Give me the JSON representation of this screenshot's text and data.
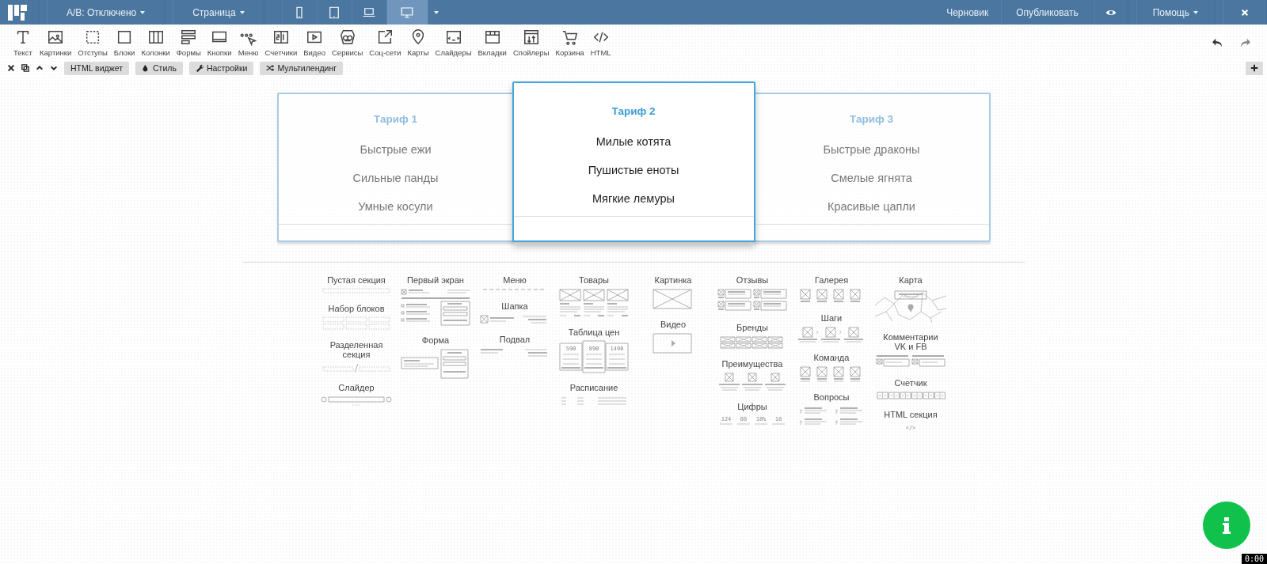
{
  "topbar": {
    "ab_test": "А/В: Отключено",
    "page_menu": "Страница",
    "devices": [
      {
        "kind": "phone",
        "selected": false
      },
      {
        "kind": "tablet",
        "selected": false
      },
      {
        "kind": "laptop",
        "selected": false
      },
      {
        "kind": "desktop",
        "selected": true
      }
    ],
    "draft": "Черновик",
    "publish": "Опубликовать",
    "help": "Помощь"
  },
  "tools": [
    {
      "kind": "text",
      "label": "Текст"
    },
    {
      "kind": "images",
      "label": "Картинки"
    },
    {
      "kind": "padding",
      "label": "Отступы"
    },
    {
      "kind": "blocks",
      "label": "Блоки"
    },
    {
      "kind": "columns",
      "label": "Колонки"
    },
    {
      "kind": "forms",
      "label": "Формы"
    },
    {
      "kind": "buttons",
      "label": "Кнопки"
    },
    {
      "kind": "menu",
      "label": "Меню"
    },
    {
      "kind": "counters",
      "label": "Счетчики"
    },
    {
      "kind": "video",
      "label": "Видео"
    },
    {
      "kind": "services",
      "label": "Сервисы"
    },
    {
      "kind": "social",
      "label": "Соц-сети"
    },
    {
      "kind": "maps",
      "label": "Карты"
    },
    {
      "kind": "sliders",
      "label": "Слайдеры"
    },
    {
      "kind": "tabs",
      "label": "Вкладки"
    },
    {
      "kind": "spoilers",
      "label": "Спойлеры"
    },
    {
      "kind": "cart",
      "label": "Корзина"
    },
    {
      "kind": "html",
      "label": "HTML"
    }
  ],
  "widget_bar": {
    "title": "HTML виджет",
    "buttons": [
      {
        "kind": "style",
        "label": "Стиль"
      },
      {
        "kind": "settings",
        "label": "Настройки"
      },
      {
        "kind": "multi",
        "label": "Мультилендинг"
      }
    ]
  },
  "pricing": [
    {
      "title": "Тариф 1",
      "selected": false,
      "features": [
        "Быстрые ежи",
        "Сильные панды",
        "Умные косули"
      ]
    },
    {
      "title": "Тариф 2",
      "selected": true,
      "features": [
        "Милые котята",
        "Пушистые еноты",
        "Мягкие лемуры"
      ]
    },
    {
      "title": "Тариф 3",
      "selected": false,
      "features": [
        "Быстрые драконы",
        "Смелые ягнята",
        "Красивые цапли"
      ]
    }
  ],
  "library": [
    {
      "items": [
        {
          "title": "Пустая секция",
          "kind": "empty"
        },
        {
          "title": "Набор блоков",
          "kind": "blocks"
        },
        {
          "title": "Разделенная секция",
          "kind": "split"
        },
        {
          "title": "Слайдер",
          "kind": "slider"
        }
      ]
    },
    {
      "items": [
        {
          "title": "Первый экран",
          "kind": "hero"
        },
        {
          "title": "Форма",
          "kind": "form"
        }
      ]
    },
    {
      "items": [
        {
          "title": "Меню",
          "kind": "menu"
        },
        {
          "title": "Шапка",
          "kind": "header"
        },
        {
          "title": "Подвал",
          "kind": "footer"
        }
      ]
    },
    {
      "items": [
        {
          "title": "Товары",
          "kind": "products"
        },
        {
          "title": "Таблица цен",
          "kind": "prices",
          "labels": [
            "590",
            "890",
            "1490"
          ]
        },
        {
          "title": "Расписание",
          "kind": "schedule"
        }
      ]
    },
    {
      "items": [
        {
          "title": "Картинка",
          "kind": "image"
        },
        {
          "title": "Видео",
          "kind": "video"
        }
      ]
    },
    {
      "items": [
        {
          "title": "Отзывы",
          "kind": "reviews"
        },
        {
          "title": "Бренды",
          "kind": "brands"
        },
        {
          "title": "Преимущества",
          "kind": "features"
        },
        {
          "title": "Цифры",
          "kind": "numbers",
          "labels": [
            "124",
            "88",
            "18%",
            "18"
          ]
        }
      ]
    },
    {
      "items": [
        {
          "title": "Галерея",
          "kind": "gallery"
        },
        {
          "title": "Шаги",
          "kind": "steps"
        },
        {
          "title": "Команда",
          "kind": "team"
        },
        {
          "title": "Вопросы",
          "kind": "faq",
          "labels": [
            "?",
            "?",
            "?",
            "?"
          ]
        }
      ]
    },
    {
      "items": [
        {
          "title": "Карта",
          "kind": "map"
        },
        {
          "title": "Комментарии VK и FB",
          "kind": "comments"
        },
        {
          "title": "Счетчик",
          "kind": "counter"
        },
        {
          "title": "HTML секция",
          "kind": "html",
          "labels": [
            "</>"
          ]
        }
      ]
    }
  ],
  "timer": "0:00"
}
